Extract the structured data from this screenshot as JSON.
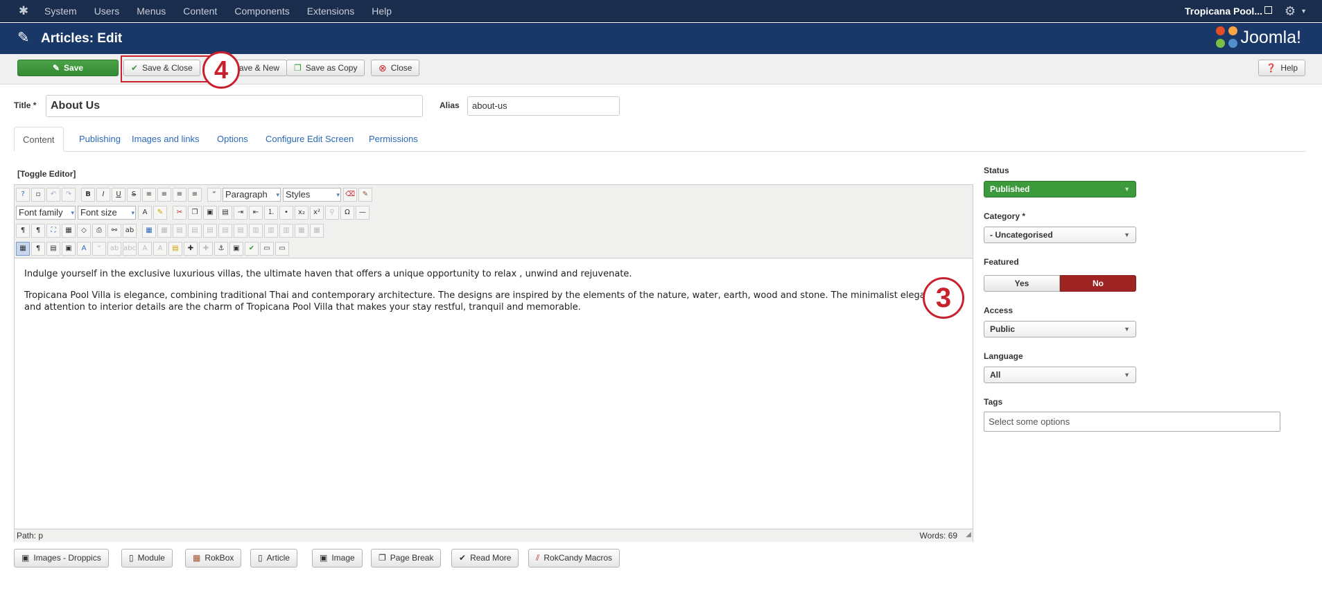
{
  "topbar": {
    "menu": [
      "System",
      "Users",
      "Menus",
      "Content",
      "Components",
      "Extensions",
      "Help"
    ],
    "site_name": "Tropicana Pool..."
  },
  "header": {
    "title": "Articles: Edit",
    "logo_text": "Joomla!"
  },
  "toolbar": {
    "save": "Save",
    "save_close": "Save & Close",
    "save_new": "Save & New",
    "save_copy": "Save as Copy",
    "close": "Close",
    "help": "Help"
  },
  "annotations": {
    "step4": "4",
    "step3": "3"
  },
  "form": {
    "title_label": "Title *",
    "title_value": "About Us",
    "alias_label": "Alias",
    "alias_value": "about-us"
  },
  "tabs": [
    "Content",
    "Publishing",
    "Images and links",
    "Options",
    "Configure Edit Screen",
    "Permissions"
  ],
  "editor": {
    "toggle": "[Toggle Editor]",
    "format_select": "Paragraph",
    "styles_select": "Styles",
    "font_family": "Font family",
    "font_size": "Font size",
    "paragraphs": [
      "Indulge yourself in the exclusive luxurious villas, the ultimate haven that offers a unique opportunity to relax , unwind and rejuvenate.",
      "Tropicana Pool Villa is elegance, combining traditional Thai and contemporary architecture. The designs are inspired by the elements of the nature, water, earth, wood and stone. The minimalist elegance and attention to interior details are the charm of Tropicana Pool Villa that makes your stay restful, tranquil and memorable."
    ],
    "path": "Path: p",
    "words": "Words: 69"
  },
  "extension_buttons": [
    "Images - Droppics",
    "Module",
    "RokBox",
    "Article",
    "Image",
    "Page Break",
    "Read More",
    "RokCandy Macros"
  ],
  "sidebar": {
    "status_label": "Status",
    "status_value": "Published",
    "category_label": "Category *",
    "category_value": "- Uncategorised",
    "featured_label": "Featured",
    "featured_yes": "Yes",
    "featured_no": "No",
    "access_label": "Access",
    "access_value": "Public",
    "language_label": "Language",
    "language_value": "All",
    "tags_label": "Tags",
    "tags_placeholder": "Select some options"
  },
  "colors": {
    "topbar_bg": "#1b2d4c",
    "header_bg": "#1a3867",
    "save_green": "#3c9a3c",
    "no_red": "#9e2424",
    "annotation_red": "#c8202c",
    "link_blue": "#2a69b8"
  }
}
